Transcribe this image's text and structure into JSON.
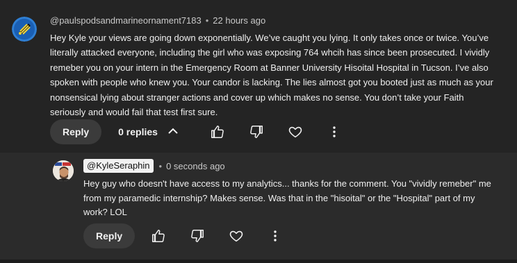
{
  "comment": {
    "author": "@paulspodsandmarineornament7183",
    "separator": "•",
    "time": "22 hours ago",
    "text": "Hey Kyle your views are going down exponentially. We’ve caught you lying. It only takes once or twice.  You’ve literally attacked everyone, including the girl who was exposing 764 whcih has since been prosecuted. I vividly remeber you on your intern in the Emergency Room at Banner University Hisoital Hospital in Tucson. I’ve also spoken with people who knew you. Your candor is lacking. The lies almost got you booted just as much as your nonsensical lying about stranger actions and cover up which makes no sense. You don’t take your Faith seriously and would fail that test first sure.",
    "reply_label": "Reply",
    "replies_label": "0 replies",
    "icons": [
      "thumb-up-icon",
      "thumb-down-icon",
      "heart-icon",
      "more-vert-icon"
    ]
  },
  "reply": {
    "author": "@KyleSeraphin",
    "separator": "•",
    "time": "0 seconds ago",
    "text": "Hey guy who doesn't have access to my analytics... thanks for the comment. You \"vividly remeber\" me from my paramedic internship? Makes sense. Was that in the \"hisoital\" or the \"Hospital\" part of my work? LOL",
    "reply_label": "Reply",
    "icons": [
      "thumb-up-icon",
      "thumb-down-icon",
      "heart-icon",
      "more-vert-icon"
    ]
  },
  "colors": {
    "background": "#242424",
    "reply_background": "#2b2b2b",
    "button_background": "#3b3b3b",
    "text": "#f1f1f1",
    "muted_text": "#aaaaaa"
  }
}
